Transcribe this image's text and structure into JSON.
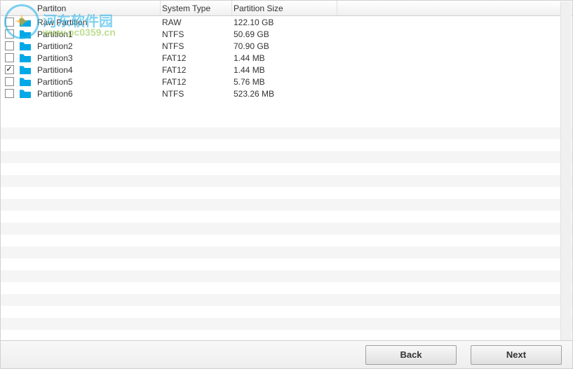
{
  "headers": {
    "partition": "Partiton",
    "system_type": "System Type",
    "partition_size": "Partition Size"
  },
  "rows": [
    {
      "checked": false,
      "name": "Raw Partition",
      "type": "RAW",
      "size": "122.10 GB"
    },
    {
      "checked": false,
      "name": "Partition1",
      "type": "NTFS",
      "size": "50.69 GB"
    },
    {
      "checked": false,
      "name": "Partition2",
      "type": "NTFS",
      "size": "70.90 GB"
    },
    {
      "checked": false,
      "name": "Partition3",
      "type": "FAT12",
      "size": "1.44 MB"
    },
    {
      "checked": true,
      "name": "Partition4",
      "type": "FAT12",
      "size": "1.44 MB"
    },
    {
      "checked": false,
      "name": "Partition5",
      "type": "FAT12",
      "size": "5.76 MB"
    },
    {
      "checked": false,
      "name": "Partition6",
      "type": "NTFS",
      "size": "523.26 MB"
    }
  ],
  "buttons": {
    "back": "Back",
    "next": "Next"
  },
  "watermark": {
    "text1": "河东软件园",
    "text2": "www.pc0359.cn"
  },
  "colors": {
    "folder_icon": "#00a8e8"
  }
}
